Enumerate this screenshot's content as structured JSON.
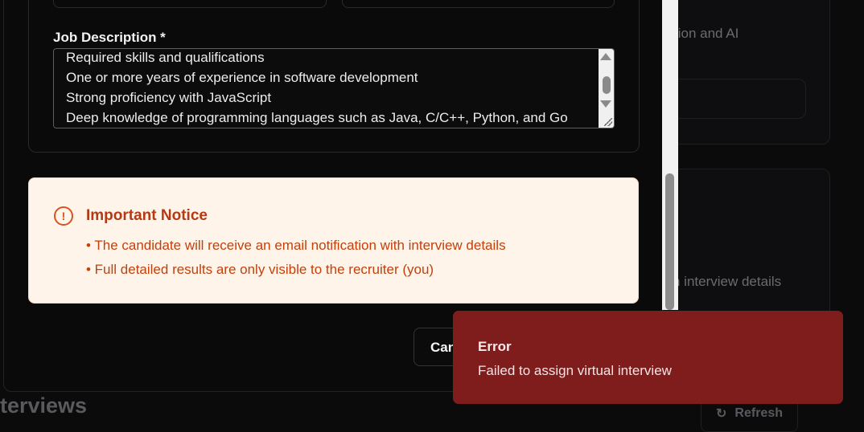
{
  "background": {
    "card_text_1": "tion and AI",
    "card_text_2": "n interview details",
    "section_heading": "terviews",
    "refresh_label": "Refresh"
  },
  "form": {
    "job_description_label": "Job Description *",
    "job_description_lines": [
      "Required skills and qualifications",
      "One or more years of experience in software development",
      "Strong proficiency with JavaScript",
      "Deep knowledge of programming languages such as Java, C/C++, Python, and Go"
    ]
  },
  "notice": {
    "icon": "!",
    "title": "Important Notice",
    "items": [
      "• The candidate will receive an email notification with interview details",
      "• Full detailed results are only visible to the recruiter (you)"
    ]
  },
  "actions": {
    "cancel_label": "Can"
  },
  "toast": {
    "title": "Error",
    "message": "Failed to assign virtual interview",
    "color": "#7f1d1d"
  },
  "colors": {
    "notice_bg": "#fef4ea",
    "notice_accent": "#c2410c"
  }
}
